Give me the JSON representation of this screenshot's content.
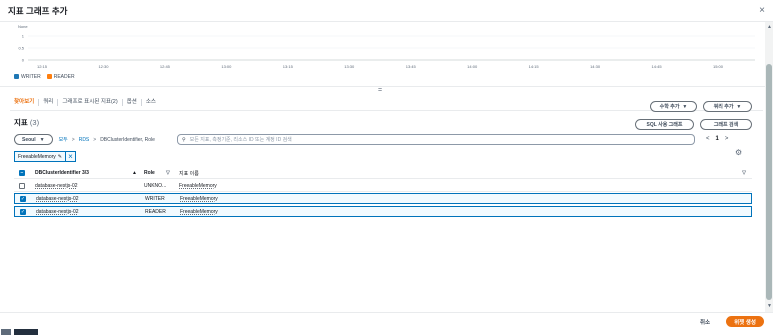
{
  "modal": {
    "title": "지표 그래프 추가",
    "close_symbol": "×"
  },
  "chart_data": {
    "type": "line",
    "ylabel": "None",
    "y_ticks": [
      "1",
      "0.5",
      "0"
    ],
    "x_ticks": [
      "12:15",
      "12:30",
      "12:45",
      "13:00",
      "13:15",
      "13:30",
      "13:45",
      "14:00",
      "14:15",
      "14:30",
      "14:45",
      "15:00"
    ],
    "series": [
      {
        "name": "WRITER",
        "values": []
      },
      {
        "name": "READER",
        "values": []
      }
    ],
    "colors": [
      "#1f77b4",
      "#ff7f0e"
    ],
    "legend_placement": "bottom-left",
    "grid": true
  },
  "tabs": [
    "찾아보기",
    "쿼리",
    "그래프로 표시된 지표(2)",
    "옵션",
    "소스"
  ],
  "actions": {
    "math": "수학 추가",
    "query": "쿼리 추가",
    "sql": "SQL 사용 그래프",
    "graph_search": "그래프 검색",
    "dropdown_symbol": "▼"
  },
  "metrics": {
    "title": "지표",
    "count": "(3)"
  },
  "breadcrumb": {
    "region": "Seoul",
    "items": [
      "모두",
      "RDS",
      "DBClusterIdentifier, Role"
    ],
    "sep": ">"
  },
  "search": {
    "placeholder": "모든 지표, 측정기준, 리소스 ID 또는 계정 ID 검색"
  },
  "pager": {
    "prev": "<",
    "page": "1",
    "next": ">"
  },
  "token": {
    "label": "FreeableMemory",
    "edit_symbol": "✎",
    "remove_symbol": "×"
  },
  "table": {
    "headers": {
      "cluster": "DBClusterIdentifier 3/3",
      "role": "Role",
      "metric": "지표 이름"
    },
    "rows": [
      {
        "cluster": "database-nestjs-02",
        "role": "UNKNO...",
        "metric": "FreeableMemory",
        "checked": false
      },
      {
        "cluster": "database-nestjs-02",
        "role": "WRITER",
        "metric": "FreeableMemory",
        "checked": true
      },
      {
        "cluster": "database-nestjs-02",
        "role": "READER",
        "metric": "FreeableMemory",
        "checked": true
      }
    ]
  },
  "footer": {
    "cancel": "취소",
    "submit": "위젯 생성"
  },
  "icons": {
    "gear": "⚙",
    "search": "🔍",
    "check": "✓",
    "minus": "−",
    "sort_asc": "▲",
    "sort_filter": "▽",
    "splitter": "="
  }
}
